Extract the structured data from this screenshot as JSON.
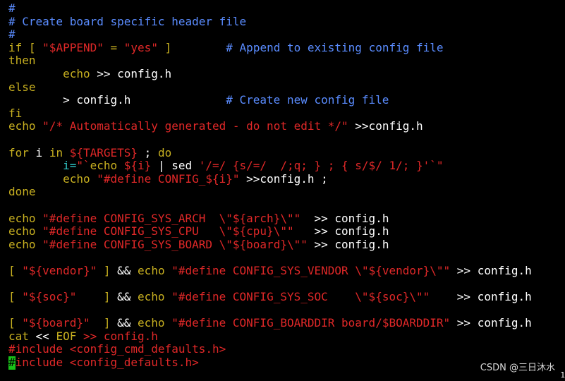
{
  "colors": {
    "background": "#000000",
    "comment": "#5a8cff",
    "keyword": "#c8b020",
    "string": "#e02828",
    "text": "#ffffff",
    "assign": "#30c8c8",
    "preproc": "#e02828",
    "cursor_bg": "#19c219",
    "cursor_fg": "#000000"
  },
  "watermark": "CSDN @三日沐水",
  "lines": [
    [
      {
        "t": "#",
        "c": "comment"
      }
    ],
    [
      {
        "t": "# Create board specific header file",
        "c": "comment"
      }
    ],
    [
      {
        "t": "#",
        "c": "comment"
      }
    ],
    [
      {
        "t": "if [ ",
        "c": "keyword"
      },
      {
        "t": "\"$APPEND\"",
        "c": "string"
      },
      {
        "t": " = ",
        "c": "keyword"
      },
      {
        "t": "\"yes\"",
        "c": "string"
      },
      {
        "t": " ]        ",
        "c": "keyword"
      },
      {
        "t": "# Append to existing config file",
        "c": "comment"
      }
    ],
    [
      {
        "t": "then",
        "c": "keyword"
      }
    ],
    [
      {
        "t": "        ",
        "c": "text"
      },
      {
        "t": "echo",
        "c": "keyword"
      },
      {
        "t": " >> config.h",
        "c": "text"
      }
    ],
    [
      {
        "t": "else",
        "c": "keyword"
      }
    ],
    [
      {
        "t": "        > config.h              ",
        "c": "text"
      },
      {
        "t": "# Create new config file",
        "c": "comment"
      }
    ],
    [
      {
        "t": "fi",
        "c": "keyword"
      }
    ],
    [
      {
        "t": "echo",
        "c": "keyword"
      },
      {
        "t": " ",
        "c": "text"
      },
      {
        "t": "\"/* Automatically generated - do not edit */\"",
        "c": "string"
      },
      {
        "t": " >>config.h",
        "c": "text"
      }
    ],
    [],
    [
      {
        "t": "for",
        "c": "keyword"
      },
      {
        "t": " i ",
        "c": "text"
      },
      {
        "t": "in",
        "c": "keyword"
      },
      {
        "t": " ",
        "c": "text"
      },
      {
        "t": "${TARGETS}",
        "c": "string"
      },
      {
        "t": " ; ",
        "c": "text"
      },
      {
        "t": "do",
        "c": "keyword"
      }
    ],
    [
      {
        "t": "        ",
        "c": "text"
      },
      {
        "t": "i=",
        "c": "assign"
      },
      {
        "t": "\"`",
        "c": "string"
      },
      {
        "t": "echo",
        "c": "keyword"
      },
      {
        "t": " ",
        "c": "text"
      },
      {
        "t": "${i}",
        "c": "string"
      },
      {
        "t": " | sed ",
        "c": "text"
      },
      {
        "t": "'/=/ {s/=/  /;q; } ; { s/$/ 1/; }'",
        "c": "string"
      },
      {
        "t": "`\"",
        "c": "string"
      }
    ],
    [
      {
        "t": "        ",
        "c": "text"
      },
      {
        "t": "echo",
        "c": "keyword"
      },
      {
        "t": " ",
        "c": "text"
      },
      {
        "t": "\"#define CONFIG_${i}\"",
        "c": "string"
      },
      {
        "t": " >>config.h ;",
        "c": "text"
      }
    ],
    [
      {
        "t": "done",
        "c": "keyword"
      }
    ],
    [],
    [
      {
        "t": "echo",
        "c": "keyword"
      },
      {
        "t": " ",
        "c": "text"
      },
      {
        "t": "\"#define CONFIG_SYS_ARCH  \\\"${arch}\\\"\"",
        "c": "string"
      },
      {
        "t": "  >> config.h",
        "c": "text"
      }
    ],
    [
      {
        "t": "echo",
        "c": "keyword"
      },
      {
        "t": " ",
        "c": "text"
      },
      {
        "t": "\"#define CONFIG_SYS_CPU   \\\"${cpu}\\\"\"",
        "c": "string"
      },
      {
        "t": "   >> config.h",
        "c": "text"
      }
    ],
    [
      {
        "t": "echo",
        "c": "keyword"
      },
      {
        "t": " ",
        "c": "text"
      },
      {
        "t": "\"#define CONFIG_SYS_BOARD \\\"${board}\\\"\"",
        "c": "string"
      },
      {
        "t": " >> config.h",
        "c": "text"
      }
    ],
    [],
    [
      {
        "t": "[ ",
        "c": "keyword"
      },
      {
        "t": "\"${vendor}\"",
        "c": "string"
      },
      {
        "t": " ] ",
        "c": "keyword"
      },
      {
        "t": "&& ",
        "c": "text"
      },
      {
        "t": "echo",
        "c": "keyword"
      },
      {
        "t": " ",
        "c": "text"
      },
      {
        "t": "\"#define CONFIG_SYS_VENDOR \\\"${vendor}\\\"\"",
        "c": "string"
      },
      {
        "t": " >> config.h",
        "c": "text"
      }
    ],
    [],
    [
      {
        "t": "[ ",
        "c": "keyword"
      },
      {
        "t": "\"${soc}\"",
        "c": "string"
      },
      {
        "t": "    ] ",
        "c": "keyword"
      },
      {
        "t": "&& ",
        "c": "text"
      },
      {
        "t": "echo",
        "c": "keyword"
      },
      {
        "t": " ",
        "c": "text"
      },
      {
        "t": "\"#define CONFIG_SYS_SOC    \\\"${soc}\\\"\"",
        "c": "string"
      },
      {
        "t": "    >> config.h",
        "c": "text"
      }
    ],
    [],
    [
      {
        "t": "[ ",
        "c": "keyword"
      },
      {
        "t": "\"${board}\"",
        "c": "string"
      },
      {
        "t": "  ] ",
        "c": "keyword"
      },
      {
        "t": "&& ",
        "c": "text"
      },
      {
        "t": "echo",
        "c": "keyword"
      },
      {
        "t": " ",
        "c": "text"
      },
      {
        "t": "\"#define CONFIG_BOARDDIR board/$BOARDDIR\"",
        "c": "string"
      },
      {
        "t": " >> config.h",
        "c": "text"
      }
    ],
    [
      {
        "t": "cat",
        "c": "keyword"
      },
      {
        "t": " << ",
        "c": "text"
      },
      {
        "t": "EOF",
        "c": "keyword"
      },
      {
        "t": " >> config.h",
        "c": "string"
      }
    ],
    [
      {
        "t": "#include <config_cmd_defaults.h>",
        "c": "preproc"
      }
    ],
    [
      {
        "t": "#",
        "c": "cursor"
      },
      {
        "t": "include <config_defaults.h>",
        "c": "preproc"
      }
    ]
  ]
}
